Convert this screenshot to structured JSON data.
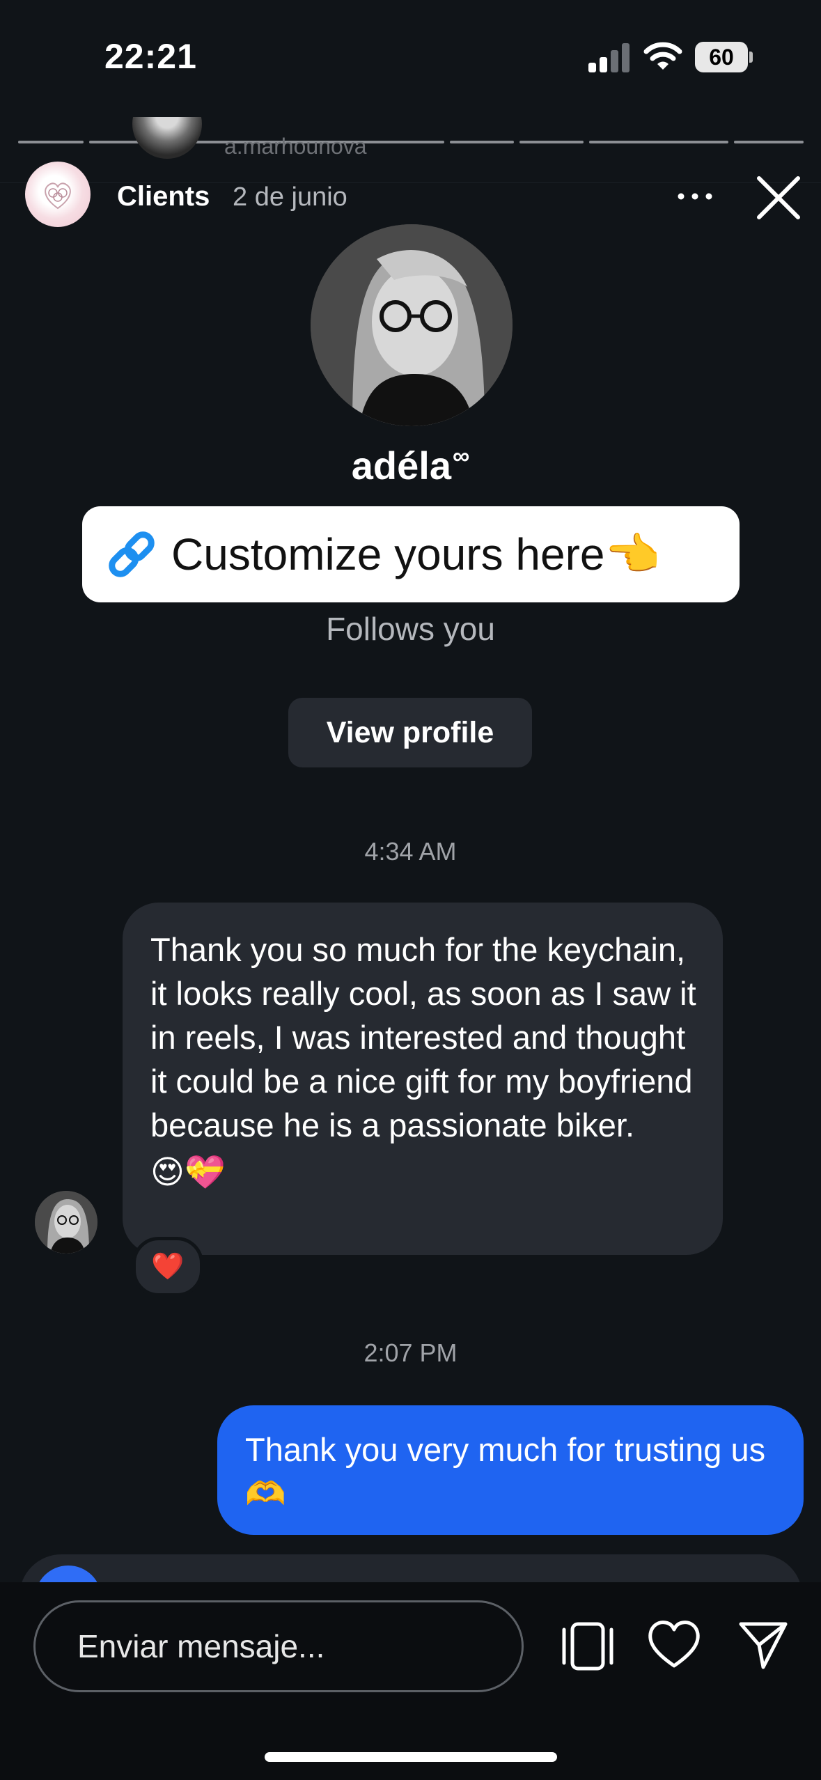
{
  "status_bar": {
    "time": "22:21",
    "battery": "60",
    "icons": [
      "signal-icon",
      "wifi-icon",
      "battery-icon"
    ]
  },
  "underlying_story": {
    "username": "a.marhounova"
  },
  "story_header": {
    "name": "Clients",
    "date": "2 de junio",
    "icons": [
      "brand-logo",
      "more-icon",
      "close-icon"
    ]
  },
  "profile": {
    "name": "adéla",
    "name_symbol": "∞",
    "link_sticker_text": "Customize yours here👈",
    "follows_you": "Follows you",
    "view_profile_label": "View profile"
  },
  "thread": {
    "messages": [
      {
        "time": "4:34 AM",
        "direction": "incoming",
        "text": "Thank you so much for the keychain, it looks really cool, as soon as I saw it in reels, I was interested and thought it could be a nice gift for my boyfriend because he is a passionate biker.",
        "emojis": "😍💝",
        "reaction": "❤️"
      },
      {
        "time": "2:07 PM",
        "direction": "outgoing",
        "text": "Thank you very much for trusting us 🫶"
      }
    ]
  },
  "reply_bar": {
    "placeholder": "Enviar mensaje...",
    "icons": [
      "stack-icon",
      "heart-icon",
      "send-icon"
    ]
  },
  "colors": {
    "background": "#101418",
    "incoming_bubble": "#262a31",
    "outgoing_bubble": "#1f64f1",
    "link_icon": "#1d8ff0"
  }
}
